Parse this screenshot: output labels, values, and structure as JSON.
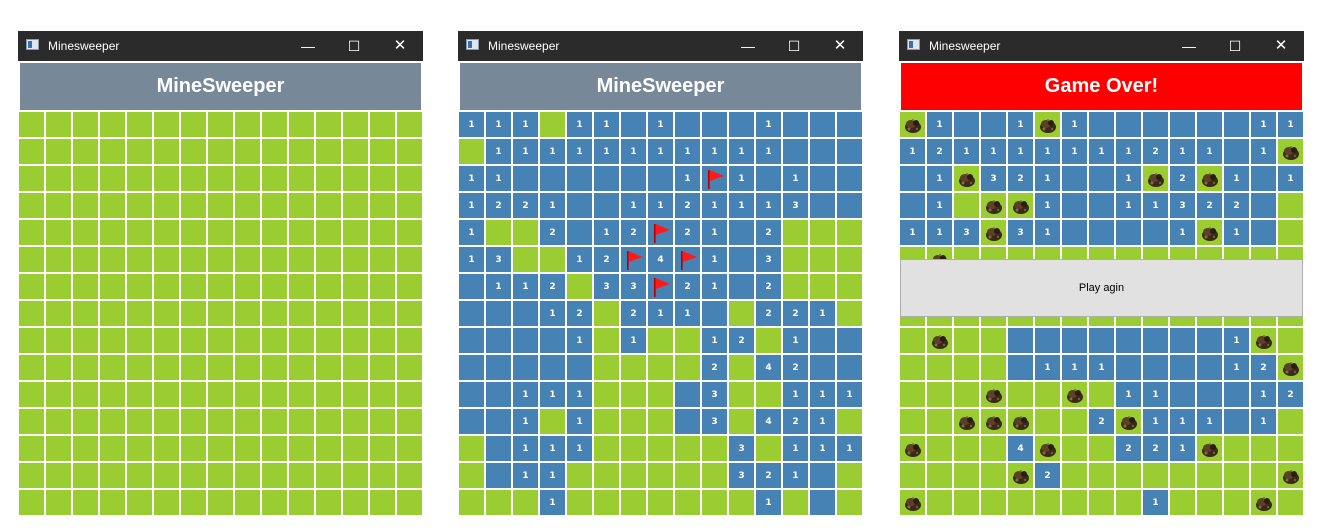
{
  "windows": [
    {
      "title": "Minesweeper",
      "controls": {
        "minimize": "—",
        "maximize": "☐",
        "close": "✕"
      },
      "header": "MineSweeper",
      "header_color": "#778899",
      "rows": [
        "g g g g g g g g g g g g g g g",
        "g g g g g g g g g g g g g g g",
        "g g g g g g g g g g g g g g g",
        "g g g g g g g g g g g g g g g",
        "g g g g g g g g g g g g g g g",
        "g g g g g g g g g g g g g g g",
        "g g g g g g g g g g g g g g g",
        "g g g g g g g g g g g g g g g",
        "g g g g g g g g g g g g g g g",
        "g g g g g g g g g g g g g g g",
        "g g g g g g g g g g g g g g g",
        "g g g g g g g g g g g g g g g",
        "g g g g g g g g g g g g g g g",
        "g g g g g g g g g g g g g g g",
        "g g g g g g g g g g g g g g g"
      ]
    },
    {
      "title": "Minesweeper",
      "controls": {
        "minimize": "—",
        "maximize": "☐",
        "close": "✕"
      },
      "header": "MineSweeper",
      "header_color": "#778899",
      "rows": [
        "1 1 1 g 1 1 b 1 b b b 1 b b b",
        "g 1 1 1 1 1 1 1 1 1 1 1 b b b",
        "1 1 b b b b b b 1 F 1 b 1 b b",
        "1 2 2 1 b b 1 1 2 1 1 1 3 b b",
        "1 g g 2 b 1 2 F 2 1 b 2 g g g",
        "1 3 g g 1 2 F 4 F 1 b 3 g g g",
        "b 1 1 2 g 3 3 F 2 1 b 2 g g g",
        "b b b 1 2 g 2 1 1 b g 2 2 1 g",
        "b b b b 1 g 1 g g 1 2 g 1 b b",
        "b b b b b g g g g 2 g 4 2 b b",
        "b b 1 1 1 g g g b 3 g g 1 1 1",
        "b b 1 g 1 g g g b 3 g 4 2 1 g",
        "g b 1 1 1 g g g g g 3 g 1 1 1",
        "g b 1 1 g g g g g g 3 2 1 b g",
        "g g g 1 g g g g g g g 1 g b g"
      ]
    },
    {
      "title": "Minesweeper",
      "controls": {
        "minimize": "—",
        "maximize": "☐",
        "close": "✕"
      },
      "header": "Game Over!",
      "header_color": "#ff0000",
      "dialog_button": "Play agin",
      "rows": [
        "M 1 b b 1 M 1 b b b b b b 1 1",
        "1 2 1 1 1 1 1 1 1 2 1 1 b 1 M",
        "b 1 M 3 2 1 b b 1 M 2 M 1 b 1",
        "b 1 g M M 1 b b 1 1 3 2 2 b g",
        "1 1 3 M 3 1 b b b b 1 M 1 b g",
        "g M g g g g g g g g g g g g g",
        "g g g g g g g g g g g g g g g",
        "g g g g g g g g g g g g g g g",
        "g M g g b b b b b b b b 1 M g",
        "g g g g b 1 1 1 b b b b 1 2 M",
        "g g g M g g M g 1 1 b b b 1 2 M",
        "g g M M M g g 2 M 1 1 1 b 1 g",
        "M g g g 4 M g g 2 2 1 M g g g",
        "g g g g M 2 g g g g g g g g M",
        "M g g g g g g g g 1 g g g M g"
      ]
    }
  ]
}
